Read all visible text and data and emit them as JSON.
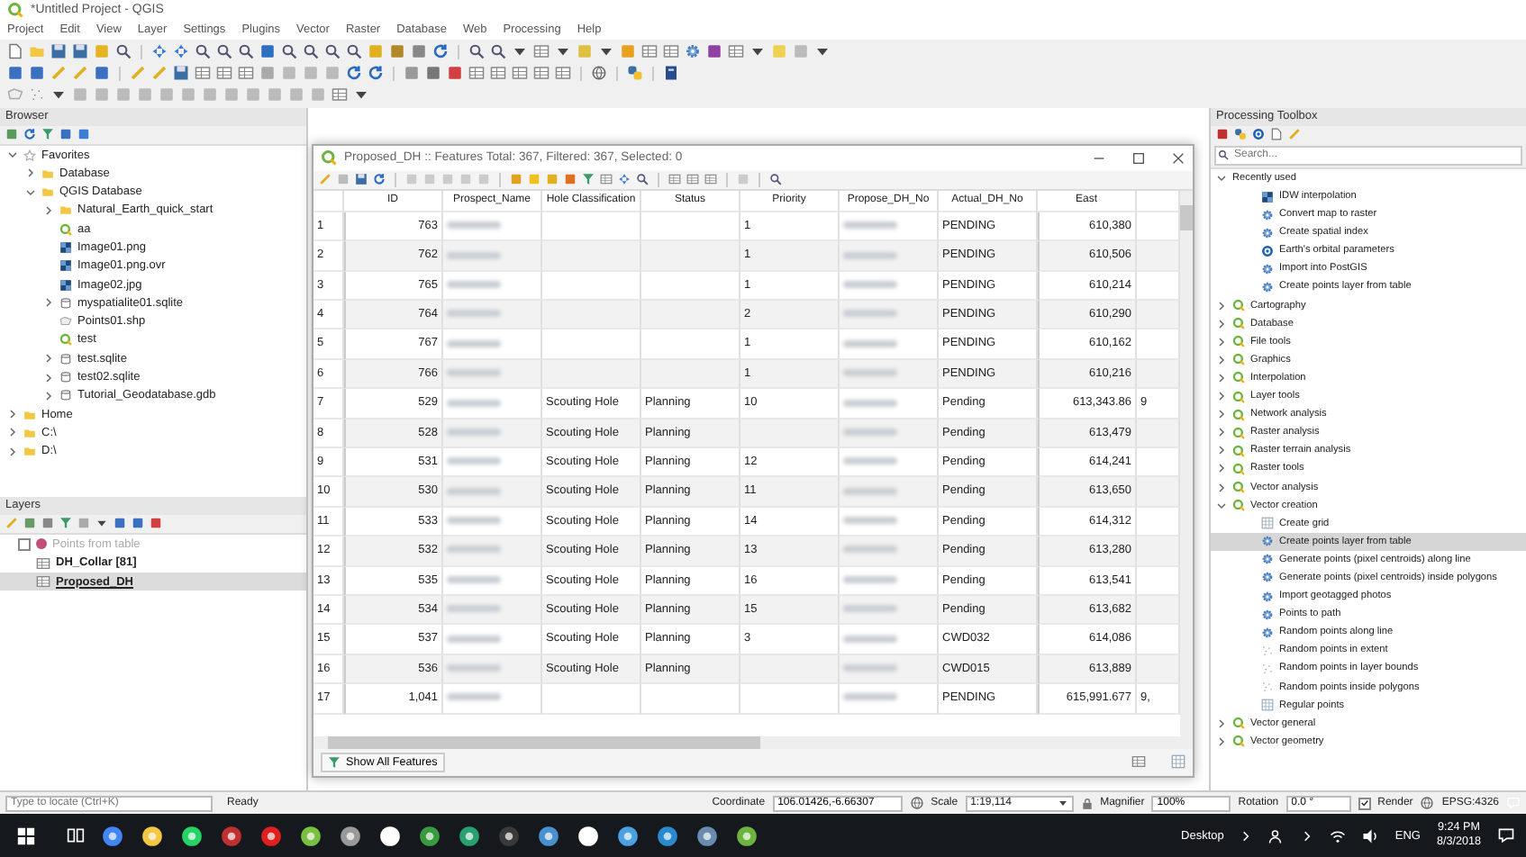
{
  "window": {
    "title": "*Untitled Project - QGIS"
  },
  "menu": [
    "Project",
    "Edit",
    "View",
    "Layer",
    "Settings",
    "Plugins",
    "Vector",
    "Raster",
    "Database",
    "Web",
    "Processing",
    "Help"
  ],
  "browser": {
    "title": "Browser",
    "tree": [
      {
        "label": "Favorites",
        "kind": "star",
        "expanded": true,
        "children": [
          {
            "label": "Database",
            "kind": "folder",
            "expanded": false
          },
          {
            "label": "QGIS Database",
            "kind": "folder",
            "expanded": true,
            "children": [
              {
                "label": "Natural_Earth_quick_start",
                "kind": "folder",
                "expanded": false
              },
              {
                "label": "aa",
                "kind": "project"
              },
              {
                "label": "Image01.png",
                "kind": "raster"
              },
              {
                "label": "Image01.png.ovr",
                "kind": "raster"
              },
              {
                "label": "Image02.jpg",
                "kind": "raster"
              },
              {
                "label": "myspatialite01.sqlite",
                "kind": "database",
                "expanded": false
              },
              {
                "label": "Points01.shp",
                "kind": "vector"
              },
              {
                "label": "test",
                "kind": "project"
              },
              {
                "label": "test.sqlite",
                "kind": "database",
                "expanded": false
              },
              {
                "label": "test02.sqlite",
                "kind": "database",
                "expanded": false
              },
              {
                "label": "Tutorial_Geodatabase.gdb",
                "kind": "database",
                "expanded": false
              }
            ]
          }
        ]
      },
      {
        "label": "Home",
        "kind": "folder",
        "expanded": false
      },
      {
        "label": "C:\\",
        "kind": "folder",
        "expanded": false
      },
      {
        "label": "D:\\",
        "kind": "folder",
        "expanded": false
      }
    ]
  },
  "layers": {
    "title": "Layers",
    "items": [
      {
        "label": "Points from table",
        "kind": "point",
        "checked": false,
        "color": "#c0507a",
        "selected": false
      },
      {
        "label": "DH_Collar [81]",
        "kind": "table",
        "selected": false
      },
      {
        "label": "Proposed_DH",
        "kind": "table",
        "selected": true
      }
    ]
  },
  "attribute_table": {
    "title": "Proposed_DH :: Features Total: 367, Filtered: 367, Selected: 0",
    "columns": [
      {
        "label": "ID"
      },
      {
        "label": "Prospect_Name",
        "blurred": true
      },
      {
        "label": "Hole Classification"
      },
      {
        "label": "Status"
      },
      {
        "label": "Priority"
      },
      {
        "label": "Propose_DH_No",
        "blurred": true
      },
      {
        "label": "Actual_DH_No"
      },
      {
        "label": "East"
      },
      {}
    ],
    "rows": [
      {
        "n": "1",
        "cells": [
          "763",
          null,
          null,
          null,
          "1",
          null,
          "PENDING",
          "610,380",
          null
        ]
      },
      {
        "n": "2",
        "cells": [
          "762",
          null,
          null,
          null,
          "1",
          null,
          "PENDING",
          "610,506",
          null
        ]
      },
      {
        "n": "3",
        "cells": [
          "765",
          null,
          null,
          null,
          "1",
          null,
          "PENDING",
          "610,214",
          null
        ]
      },
      {
        "n": "4",
        "cells": [
          "764",
          null,
          null,
          null,
          "2",
          null,
          "PENDING",
          "610,290",
          null
        ]
      },
      {
        "n": "5",
        "cells": [
          "767",
          null,
          null,
          null,
          "1",
          null,
          "PENDING",
          "610,162",
          null
        ]
      },
      {
        "n": "6",
        "cells": [
          "766",
          null,
          null,
          null,
          "1",
          null,
          "PENDING",
          "610,216",
          null
        ]
      },
      {
        "n": "7",
        "cells": [
          "529",
          null,
          "Scouting Hole",
          "Planning",
          "10",
          null,
          "Pending",
          "613,343.86",
          "9"
        ]
      },
      {
        "n": "8",
        "cells": [
          "528",
          null,
          "Scouting Hole",
          "Planning",
          null,
          null,
          "Pending",
          "613,479",
          null
        ]
      },
      {
        "n": "9",
        "cells": [
          "531",
          null,
          "Scouting Hole",
          "Planning",
          "12",
          null,
          "Pending",
          "614,241",
          null
        ]
      },
      {
        "n": "10",
        "cells": [
          "530",
          null,
          "Scouting Hole",
          "Planning",
          "11",
          null,
          "Pending",
          "613,650",
          null
        ]
      },
      {
        "n": "11",
        "cells": [
          "533",
          null,
          "Scouting Hole",
          "Planning",
          "14",
          null,
          "Pending",
          "614,312",
          null
        ]
      },
      {
        "n": "12",
        "cells": [
          "532",
          null,
          "Scouting Hole",
          "Planning",
          "13",
          null,
          "Pending",
          "613,280",
          null
        ]
      },
      {
        "n": "13",
        "cells": [
          "535",
          null,
          "Scouting Hole",
          "Planning",
          "16",
          null,
          "Pending",
          "613,541",
          null
        ]
      },
      {
        "n": "14",
        "cells": [
          "534",
          null,
          "Scouting Hole",
          "Planning",
          "15",
          null,
          "Pending",
          "613,682",
          null
        ]
      },
      {
        "n": "15",
        "cells": [
          "537",
          null,
          "Scouting Hole",
          "Planning",
          "3",
          null,
          "CWD032",
          "614,086",
          null
        ]
      },
      {
        "n": "16",
        "cells": [
          "536",
          null,
          "Scouting Hole",
          "Planning",
          null,
          null,
          "CWD015",
          "613,889",
          null
        ]
      },
      {
        "n": "17",
        "cells": [
          "1,041",
          null,
          null,
          null,
          null,
          null,
          "PENDING",
          "615,991.677",
          "9,"
        ]
      }
    ],
    "filter_button": "Show All Features"
  },
  "toolbox": {
    "title": "Processing Toolbox",
    "placeholder": "Search...",
    "tree": [
      {
        "label": "Recently used",
        "expanded": true,
        "children": [
          {
            "label": "IDW interpolation",
            "kind": "raster",
            "selected": false
          },
          {
            "label": "Convert map to raster",
            "kind": "gear",
            "selected": false
          },
          {
            "label": "Create spatial index",
            "kind": "gear",
            "selected": false
          },
          {
            "label": "Earth's orbital parameters",
            "kind": "ring",
            "selected": false
          },
          {
            "label": "Import into PostGIS",
            "kind": "gear",
            "selected": false
          },
          {
            "label": "Create points layer from table",
            "kind": "gear",
            "selected": false
          }
        ]
      },
      {
        "label": "Cartography",
        "kind": "project",
        "expanded": false
      },
      {
        "label": "Database",
        "kind": "project",
        "expanded": false
      },
      {
        "label": "File tools",
        "kind": "project",
        "expanded": false
      },
      {
        "label": "Graphics",
        "kind": "project",
        "expanded": false
      },
      {
        "label": "Interpolation",
        "kind": "project",
        "expanded": false
      },
      {
        "label": "Layer tools",
        "kind": "project",
        "expanded": false
      },
      {
        "label": "Network analysis",
        "kind": "project",
        "expanded": false
      },
      {
        "label": "Raster analysis",
        "kind": "project",
        "expanded": false
      },
      {
        "label": "Raster terrain analysis",
        "kind": "project",
        "expanded": false
      },
      {
        "label": "Raster tools",
        "kind": "project",
        "expanded": false
      },
      {
        "label": "Vector analysis",
        "kind": "project",
        "expanded": false
      },
      {
        "label": "Vector creation",
        "kind": "project",
        "expanded": true,
        "children": [
          {
            "label": "Create grid",
            "kind": "grid",
            "selected": false
          },
          {
            "label": "Create points layer from table",
            "kind": "gear",
            "selected": true
          },
          {
            "label": "Generate points (pixel centroids) along line",
            "kind": "gear",
            "selected": false
          },
          {
            "label": "Generate points (pixel centroids) inside polygons",
            "kind": "gear",
            "selected": false
          },
          {
            "label": "Import geotagged photos",
            "kind": "gear",
            "selected": false
          },
          {
            "label": "Points to path",
            "kind": "gear",
            "selected": false
          },
          {
            "label": "Random points along line",
            "kind": "gear",
            "selected": false
          },
          {
            "label": "Random points in extent",
            "kind": "dots",
            "selected": false
          },
          {
            "label": "Random points in layer bounds",
            "kind": "dots",
            "selected": false
          },
          {
            "label": "Random points inside polygons",
            "kind": "dots",
            "selected": false
          },
          {
            "label": "Regular points",
            "kind": "grid",
            "selected": false
          }
        ]
      },
      {
        "label": "Vector general",
        "kind": "project",
        "expanded": false
      },
      {
        "label": "Vector geometry",
        "kind": "project",
        "expanded": false
      }
    ]
  },
  "status_bar": {
    "locate_placeholder": "Type to locate (Ctrl+K)",
    "message": "Ready",
    "coordinate_label": "Coordinate",
    "coordinate": "106.01426,-6.66307",
    "scale_label": "Scale",
    "scale": "1:19,114",
    "magnifier_label": "Magnifier",
    "magnifier": "100%",
    "rotation_label": "Rotation",
    "rotation": "0.0 °",
    "render": {
      "label": "Render",
      "checked": true
    },
    "crs": "EPSG:4326"
  },
  "taskbar": {
    "desktop": "Desktop",
    "language": "ENG",
    "time": "9:24 PM",
    "date": "8/3/2018"
  }
}
